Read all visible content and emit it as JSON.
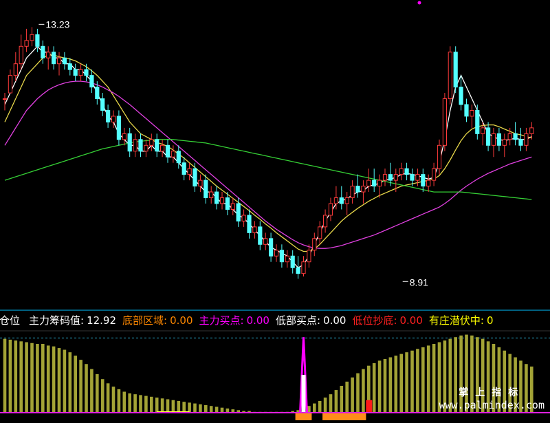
{
  "labels": {
    "high_marker": "13.23",
    "low_marker": "8.91"
  },
  "indicator_bar": {
    "items": [
      {
        "label": "仓位",
        "value": "",
        "color": "#ffffff"
      },
      {
        "label": "主力筹码值:",
        "value": "12.92",
        "color": "#ffffff"
      },
      {
        "label": "底部区域:",
        "value": "0.00",
        "color": "#ff8800"
      },
      {
        "label": "主力买点:",
        "value": "0.00",
        "color": "#ff00ff"
      },
      {
        "label": "低部买点:",
        "value": "0.00",
        "color": "#ffffff"
      },
      {
        "label": "低位抄底:",
        "value": "0.00",
        "color": "#ff2020"
      },
      {
        "label": "有庄潜伏中:",
        "value": "0",
        "color": "#ffff00"
      }
    ]
  },
  "watermark": {
    "line1": "掌上指标",
    "line2": "www.palmindex.com"
  },
  "colors": {
    "up_candle": "#ff3b3b",
    "down_candle": "#54ffff",
    "ma_white": "#ffffff",
    "ma_yellow": "#e8d84a",
    "ma_magenta": "#e040e0",
    "ma_green": "#35cf35",
    "olive_bar": "#a3a336",
    "spike": "#ff00ff",
    "orange": "#ff8c1a",
    "red_block": "#ff1a1a",
    "bottom_line": "#e020e0",
    "divider": "#00bfff"
  },
  "chart_data": [
    {
      "type": "candlestick",
      "title": "",
      "ylim": [
        8.5,
        13.6
      ],
      "annotations": [
        {
          "text": "13.23",
          "x": 6,
          "y": 13.23
        },
        {
          "text": "8.91",
          "x": 73,
          "y": 8.91
        }
      ],
      "candles": [
        [
          12.0,
          12.1,
          11.8,
          12.0
        ],
        [
          12.1,
          12.5,
          12.1,
          12.4
        ],
        [
          12.4,
          12.8,
          12.3,
          12.6
        ],
        [
          12.6,
          13.1,
          12.5,
          12.9
        ],
        [
          12.9,
          13.2,
          12.8,
          13.0
        ],
        [
          13.0,
          13.23,
          12.9,
          13.1
        ],
        [
          13.1,
          13.2,
          12.8,
          12.9
        ],
        [
          12.9,
          13.0,
          12.6,
          12.7
        ],
        [
          12.7,
          12.9,
          12.5,
          12.8
        ],
        [
          12.8,
          12.9,
          12.5,
          12.6
        ],
        [
          12.6,
          12.8,
          12.4,
          12.7
        ],
        [
          12.7,
          12.8,
          12.5,
          12.6
        ],
        [
          12.6,
          12.7,
          12.4,
          12.5
        ],
        [
          12.5,
          12.6,
          12.3,
          12.4
        ],
        [
          12.4,
          12.6,
          12.3,
          12.5
        ],
        [
          12.5,
          12.6,
          12.3,
          12.4
        ],
        [
          12.4,
          12.5,
          12.1,
          12.2
        ],
        [
          12.2,
          12.3,
          11.9,
          12.0
        ],
        [
          12.0,
          12.1,
          11.7,
          11.8
        ],
        [
          11.8,
          11.9,
          11.5,
          11.6
        ],
        [
          11.6,
          11.8,
          11.5,
          11.7
        ],
        [
          11.7,
          11.8,
          11.2,
          11.3
        ],
        [
          11.3,
          11.5,
          11.2,
          11.4
        ],
        [
          11.4,
          11.5,
          11.0,
          11.1
        ],
        [
          11.1,
          11.4,
          11.0,
          11.3
        ],
        [
          11.3,
          11.4,
          11.0,
          11.1
        ],
        [
          11.1,
          11.3,
          11.0,
          11.2
        ],
        [
          11.2,
          11.4,
          11.1,
          11.3
        ],
        [
          11.3,
          11.4,
          11.0,
          11.1
        ],
        [
          11.1,
          11.3,
          11.0,
          11.2
        ],
        [
          11.2,
          11.3,
          10.9,
          11.0
        ],
        [
          11.0,
          11.2,
          10.9,
          11.1
        ],
        [
          11.1,
          11.2,
          10.8,
          10.9
        ],
        [
          10.9,
          11.0,
          10.6,
          10.7
        ],
        [
          10.7,
          10.9,
          10.6,
          10.8
        ],
        [
          10.8,
          10.9,
          10.4,
          10.5
        ],
        [
          10.5,
          10.7,
          10.4,
          10.6
        ],
        [
          10.6,
          10.7,
          10.2,
          10.3
        ],
        [
          10.3,
          10.5,
          10.2,
          10.4
        ],
        [
          10.4,
          10.5,
          10.1,
          10.2
        ],
        [
          10.2,
          10.4,
          10.1,
          10.3
        ],
        [
          10.3,
          10.4,
          10.0,
          10.1
        ],
        [
          10.1,
          10.3,
          10.0,
          10.2
        ],
        [
          10.2,
          10.3,
          9.8,
          9.9
        ],
        [
          9.9,
          10.1,
          9.8,
          10.0
        ],
        [
          10.0,
          10.1,
          9.6,
          9.7
        ],
        [
          9.7,
          9.9,
          9.6,
          9.8
        ],
        [
          9.8,
          9.9,
          9.4,
          9.5
        ],
        [
          9.5,
          9.7,
          9.4,
          9.6
        ],
        [
          9.6,
          9.7,
          9.2,
          9.3
        ],
        [
          9.3,
          9.5,
          9.2,
          9.4
        ],
        [
          9.4,
          9.5,
          9.1,
          9.2
        ],
        [
          9.2,
          9.4,
          9.1,
          9.3
        ],
        [
          9.3,
          9.4,
          9.0,
          9.1
        ],
        [
          9.1,
          9.3,
          8.91,
          9.0
        ],
        [
          9.0,
          9.3,
          8.95,
          9.2
        ],
        [
          9.2,
          9.5,
          9.1,
          9.4
        ],
        [
          9.4,
          9.7,
          9.3,
          9.6
        ],
        [
          9.6,
          9.9,
          9.5,
          9.8
        ],
        [
          9.8,
          10.1,
          9.7,
          10.0
        ],
        [
          10.0,
          10.3,
          9.9,
          10.2
        ],
        [
          10.2,
          10.5,
          10.1,
          10.3
        ],
        [
          10.3,
          10.5,
          10.1,
          10.2
        ],
        [
          10.2,
          10.4,
          10.0,
          10.3
        ],
        [
          10.3,
          10.6,
          10.2,
          10.5
        ],
        [
          10.5,
          10.7,
          10.3,
          10.4
        ],
        [
          10.4,
          10.6,
          10.2,
          10.5
        ],
        [
          10.5,
          10.8,
          10.4,
          10.6
        ],
        [
          10.6,
          10.8,
          10.4,
          10.5
        ],
        [
          10.5,
          10.7,
          10.3,
          10.6
        ],
        [
          10.6,
          10.8,
          10.5,
          10.7
        ],
        [
          10.7,
          10.9,
          10.5,
          10.6
        ],
        [
          10.6,
          10.8,
          10.4,
          10.7
        ],
        [
          10.7,
          10.9,
          10.6,
          10.8
        ],
        [
          10.8,
          10.9,
          10.6,
          10.7
        ],
        [
          10.7,
          10.8,
          10.5,
          10.6
        ],
        [
          10.6,
          10.8,
          10.5,
          10.7
        ],
        [
          10.7,
          10.8,
          10.4,
          10.5
        ],
        [
          10.5,
          10.7,
          10.4,
          10.6
        ],
        [
          10.6,
          10.9,
          10.5,
          10.8
        ],
        [
          10.8,
          11.3,
          10.7,
          11.2
        ],
        [
          11.2,
          12.1,
          11.1,
          12.0
        ],
        [
          12.0,
          12.9,
          11.9,
          12.8
        ],
        [
          12.8,
          12.9,
          12.1,
          12.2
        ],
        [
          12.2,
          12.4,
          11.8,
          11.9
        ],
        [
          11.9,
          12.0,
          11.6,
          11.7
        ],
        [
          11.7,
          11.9,
          11.5,
          11.8
        ],
        [
          11.8,
          11.9,
          11.3,
          11.4
        ],
        [
          11.4,
          11.6,
          11.2,
          11.5
        ],
        [
          11.5,
          11.6,
          11.1,
          11.2
        ],
        [
          11.2,
          11.5,
          11.0,
          11.4
        ],
        [
          11.4,
          11.5,
          11.1,
          11.2
        ],
        [
          11.2,
          11.4,
          11.0,
          11.3
        ],
        [
          11.3,
          11.5,
          11.2,
          11.4
        ],
        [
          11.4,
          11.6,
          11.2,
          11.3
        ],
        [
          11.3,
          11.5,
          11.1,
          11.2
        ],
        [
          11.2,
          11.5,
          11.1,
          11.4
        ],
        [
          11.4,
          11.6,
          11.3,
          11.5
        ]
      ],
      "series": [
        {
          "color": "#ffffff",
          "values": [
            11.9,
            12.1,
            12.3,
            12.5,
            12.7,
            12.8,
            12.9,
            12.8,
            12.8,
            12.7,
            12.7,
            12.6,
            12.6,
            12.5,
            12.5,
            12.4,
            12.3,
            12.1,
            11.9,
            11.7,
            11.6,
            11.4,
            11.3,
            11.2,
            11.2,
            11.1,
            11.1,
            11.2,
            11.1,
            11.1,
            11.0,
            11.0,
            10.9,
            10.8,
            10.7,
            10.6,
            10.5,
            10.4,
            10.4,
            10.3,
            10.2,
            10.2,
            10.1,
            10.0,
            9.95,
            9.85,
            9.75,
            9.65,
            9.55,
            9.45,
            9.4,
            9.35,
            9.3,
            9.2,
            9.1,
            9.15,
            9.3,
            9.5,
            9.7,
            9.9,
            10.05,
            10.2,
            10.25,
            10.28,
            10.35,
            10.4,
            10.42,
            10.5,
            10.52,
            10.55,
            10.6,
            10.62,
            10.65,
            10.7,
            10.72,
            10.7,
            10.68,
            10.65,
            10.62,
            10.65,
            10.9,
            11.3,
            11.8,
            12.2,
            12.4,
            12.2,
            12.0,
            11.8,
            11.6,
            11.4,
            11.35,
            11.3,
            11.28,
            11.3,
            11.32,
            11.3,
            11.3,
            11.35
          ]
        },
        {
          "color": "#e8d84a",
          "values": [
            11.6,
            11.8,
            12.0,
            12.2,
            12.4,
            12.5,
            12.6,
            12.7,
            12.75,
            12.75,
            12.72,
            12.7,
            12.68,
            12.65,
            12.6,
            12.55,
            12.48,
            12.4,
            12.3,
            12.2,
            12.05,
            11.9,
            11.75,
            11.6,
            11.5,
            11.4,
            11.35,
            11.3,
            11.25,
            11.22,
            11.18,
            11.12,
            11.05,
            10.98,
            10.9,
            10.82,
            10.74,
            10.66,
            10.58,
            10.5,
            10.43,
            10.36,
            10.29,
            10.22,
            10.15,
            10.08,
            10.0,
            9.93,
            9.85,
            9.78,
            9.7,
            9.63,
            9.56,
            9.49,
            9.42,
            9.38,
            9.38,
            9.42,
            9.5,
            9.6,
            9.7,
            9.8,
            9.9,
            9.98,
            10.05,
            10.12,
            10.18,
            10.24,
            10.29,
            10.34,
            10.38,
            10.42,
            10.46,
            10.5,
            10.52,
            10.54,
            10.56,
            10.58,
            10.6,
            10.62,
            10.68,
            10.8,
            10.95,
            11.12,
            11.28,
            11.4,
            11.48,
            11.52,
            11.54,
            11.55,
            11.55,
            11.52,
            11.48,
            11.44,
            11.4,
            11.38,
            11.35,
            11.33
          ]
        },
        {
          "color": "#e040e0",
          "values": [
            11.2,
            11.35,
            11.5,
            11.65,
            11.8,
            11.9,
            12.0,
            12.08,
            12.15,
            12.2,
            12.24,
            12.27,
            12.29,
            12.3,
            12.3,
            12.29,
            12.27,
            12.24,
            12.2,
            12.15,
            12.1,
            12.04,
            11.97,
            11.9,
            11.82,
            11.74,
            11.66,
            11.58,
            11.5,
            11.42,
            11.34,
            11.26,
            11.18,
            11.1,
            11.02,
            10.94,
            10.86,
            10.78,
            10.7,
            10.62,
            10.54,
            10.46,
            10.38,
            10.3,
            10.22,
            10.14,
            10.06,
            9.98,
            9.9,
            9.83,
            9.76,
            9.7,
            9.64,
            9.58,
            9.53,
            9.49,
            9.46,
            9.44,
            9.43,
            9.43,
            9.44,
            9.46,
            9.48,
            9.51,
            9.54,
            9.57,
            9.6,
            9.63,
            9.66,
            9.7,
            9.74,
            9.78,
            9.82,
            9.86,
            9.9,
            9.94,
            9.98,
            10.02,
            10.06,
            10.1,
            10.14,
            10.2,
            10.27,
            10.35,
            10.43,
            10.5,
            10.56,
            10.62,
            10.67,
            10.72,
            10.76,
            10.8,
            10.84,
            10.88,
            10.91,
            10.94,
            10.97,
            11.0
          ]
        },
        {
          "color": "#35cf35",
          "values": [
            10.6,
            10.63,
            10.66,
            10.69,
            10.72,
            10.75,
            10.78,
            10.81,
            10.84,
            10.87,
            10.9,
            10.93,
            10.96,
            10.99,
            11.02,
            11.05,
            11.08,
            11.11,
            11.14,
            11.16,
            11.18,
            11.2,
            11.22,
            11.24,
            11.26,
            11.27,
            11.28,
            11.29,
            11.3,
            11.3,
            11.3,
            11.3,
            11.29,
            11.28,
            11.27,
            11.26,
            11.25,
            11.24,
            11.22,
            11.2,
            11.18,
            11.16,
            11.14,
            11.12,
            11.1,
            11.08,
            11.06,
            11.04,
            11.02,
            11.0,
            10.98,
            10.96,
            10.94,
            10.92,
            10.9,
            10.88,
            10.86,
            10.84,
            10.82,
            10.8,
            10.78,
            10.76,
            10.74,
            10.72,
            10.7,
            10.68,
            10.66,
            10.64,
            10.62,
            10.6,
            10.58,
            10.56,
            10.54,
            10.52,
            10.5,
            10.48,
            10.46,
            10.44,
            10.42,
            10.4,
            10.4,
            10.4,
            10.4,
            10.4,
            10.4,
            10.39,
            10.38,
            10.37,
            10.36,
            10.35,
            10.34,
            10.33,
            10.32,
            10.31,
            10.3,
            10.29,
            10.28,
            10.27
          ]
        }
      ]
    },
    {
      "type": "bar",
      "title": "",
      "ylim": [
        0,
        1
      ],
      "olive_values": [
        0.88,
        0.87,
        0.86,
        0.85,
        0.84,
        0.83,
        0.82,
        0.82,
        0.8,
        0.79,
        0.77,
        0.75,
        0.72,
        0.68,
        0.63,
        0.58,
        0.52,
        0.46,
        0.4,
        0.35,
        0.31,
        0.28,
        0.25,
        0.23,
        0.22,
        0.21,
        0.2,
        0.19,
        0.18,
        0.17,
        0.16,
        0.15,
        0.14,
        0.13,
        0.12,
        0.11,
        0.1,
        0.09,
        0.08,
        0.07,
        0.06,
        0.05,
        0.04,
        0.03,
        0.02,
        0.02,
        0.01,
        0.01,
        0.01,
        0.01,
        0.01,
        0.01,
        0.01,
        0.02,
        0.03,
        0.05,
        0.08,
        0.11,
        0.14,
        0.18,
        0.22,
        0.27,
        0.32,
        0.37,
        0.42,
        0.47,
        0.52,
        0.56,
        0.59,
        0.62,
        0.64,
        0.66,
        0.68,
        0.7,
        0.72,
        0.74,
        0.76,
        0.78,
        0.8,
        0.82,
        0.84,
        0.86,
        0.88,
        0.9,
        0.92,
        0.93,
        0.92,
        0.9,
        0.88,
        0.85,
        0.82,
        0.78,
        0.74,
        0.7,
        0.66,
        0.62,
        0.58,
        0.55
      ],
      "spike": {
        "index": 55,
        "value": 0.9
      },
      "red_block": {
        "index": 67,
        "value": 0.15
      },
      "orange_markers": [
        [
          54,
          56
        ],
        [
          59,
          66
        ]
      ],
      "yellow_segment": [
        28,
        34
      ],
      "dashed_reference": 0.89
    }
  ]
}
